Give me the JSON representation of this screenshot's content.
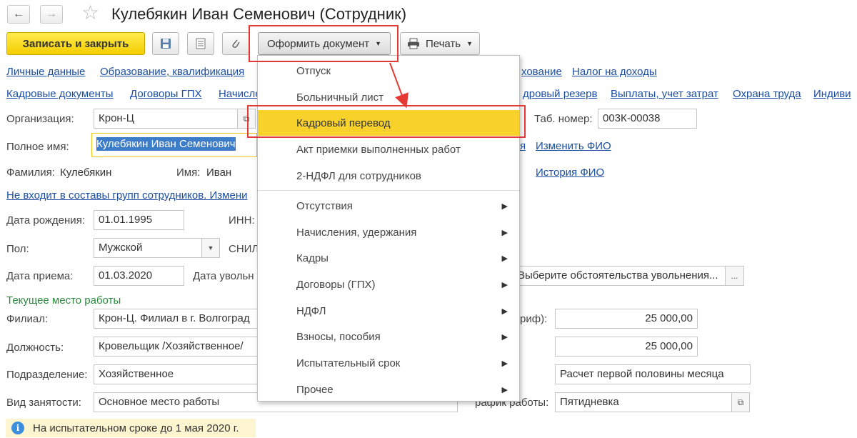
{
  "header": {
    "title": "Кулебякин Иван Семенович (Сотрудник)",
    "back_icon": "arrow-left-icon",
    "forward_icon": "arrow-right-icon",
    "favorite_icon": "star-icon"
  },
  "toolbar": {
    "save_close_label": "Записать и закрыть",
    "save_icon": "floppy-disk-icon",
    "list_icon": "list-icon",
    "attach_icon": "paperclip-icon",
    "create_doc_label": "Оформить документ",
    "print_label": "Печать"
  },
  "nav_links": {
    "row1": [
      "Личные данные",
      "Образование, квалификация",
      "хование",
      "Налог на доходы"
    ],
    "row2": [
      "Кадровые документы",
      "Договоры ГПХ",
      "Начисле",
      "дровый резерв",
      "Выплаты, учет затрат",
      "Охрана труда",
      "Индиви"
    ]
  },
  "form": {
    "org_label": "Организация:",
    "org_value": "Крон-Ц",
    "tab_no_label": "Таб. номер:",
    "tab_no_value": "003К-00038",
    "fullname_label": "Полное имя:",
    "fullname_value": "Кулебякин Иван Семенович",
    "fullname_link_tail": "я",
    "change_fio_link": "Изменить ФИО",
    "surname_label": "Фамилия:",
    "surname_value": "Кулебякин",
    "name_label": "Имя:",
    "name_value": "Иван",
    "fio_history_link": "История ФИО",
    "groups_link": "Не входит в составы групп сотрудников. Измени",
    "birth_label": "Дата рождения:",
    "birth_value": "01.01.1995",
    "inn_label": "ИНН:",
    "sex_label": "Пол:",
    "sex_value": "Мужской",
    "snils_label": "СНИЛ",
    "hire_label": "Дата приема:",
    "hire_value": "01.03.2020",
    "dismiss_label": "Дата увольн",
    "dismiss_reason_value": "Выберите обстоятельства увольнения...",
    "current_work_section": "Текущее место работы",
    "branch_label": "Филиал:",
    "branch_value": "Крон-Ц. Филиал в г. Волгоград",
    "tariff_label_tail": "риф):",
    "tariff_value": "25 000,00",
    "position_label": "Должность:",
    "position_value": "Кровельщик /Хозяйственное/",
    "salary_value": "25 000,00",
    "dept_label": "Подразделение:",
    "dept_value": "Хозяйственное",
    "calc_value": "Расчет первой половины месяца",
    "employment_label": "Вид занятости:",
    "employment_value": "Основное место работы",
    "schedule_label_tail": "рафик работы:",
    "schedule_value": "Пятидневка"
  },
  "info_bar": {
    "icon": "info-icon",
    "text": "На испытательном сроке до 1 мая 2020 г."
  },
  "dropdown_menu": {
    "items": [
      {
        "label": "Отпуск",
        "submenu": false
      },
      {
        "label": "Больничный лист",
        "submenu": false
      },
      {
        "label": "Кадровый перевод",
        "submenu": false,
        "selected": true
      },
      {
        "label": "Акт приемки выполненных работ",
        "submenu": false
      },
      {
        "label": "2-НДФЛ для сотрудников",
        "submenu": false
      },
      {
        "label": "Отсутствия",
        "submenu": true
      },
      {
        "label": "Начисления, удержания",
        "submenu": true
      },
      {
        "label": "Кадры",
        "submenu": true
      },
      {
        "label": "Договоры (ГПХ)",
        "submenu": true
      },
      {
        "label": "НДФЛ",
        "submenu": true
      },
      {
        "label": "Взносы, пособия",
        "submenu": true
      },
      {
        "label": "Испытательный срок",
        "submenu": true
      },
      {
        "label": "Прочее",
        "submenu": true
      }
    ]
  },
  "colors": {
    "primary_button": "#f4cd00",
    "link": "#1b4ea3",
    "selected_item": "#f8d12a",
    "highlight_frame": "#e53935",
    "section_heading": "#2b8a3e"
  }
}
